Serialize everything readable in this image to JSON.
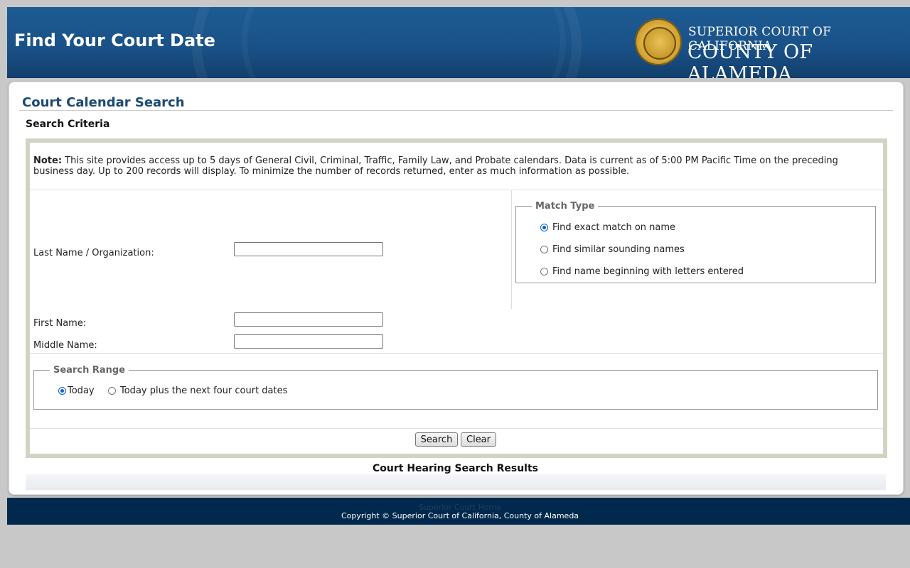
{
  "header": {
    "title": "Find Your Court Date",
    "court_line1": "SUPERIOR COURT OF CALIFORNIA",
    "court_line2": "COUNTY OF ALAMEDA"
  },
  "main": {
    "page_title": "Court Calendar Search",
    "criteria_heading": "Search Criteria",
    "note_label": "Note:",
    "note_text": " This site provides access up to 5 days of General Civil, Criminal, Traffic, Family Law, and Probate calendars. Data is current as of 5:00 PM Pacific Time on the preceding business day. Up to 200 records will display. To minimize the number of records returned, enter as much information as possible.",
    "fields": {
      "last_name_label": "Last Name / Organization:",
      "last_name_value": "",
      "first_name_label": "First Name:",
      "first_name_value": "",
      "middle_name_label": "Middle Name:",
      "middle_name_value": ""
    },
    "match_type": {
      "legend": "Match Type",
      "options": [
        {
          "label": "Find exact match on name",
          "checked": true
        },
        {
          "label": "Find similar sounding names",
          "checked": false
        },
        {
          "label": "Find name beginning with letters entered",
          "checked": false
        }
      ]
    },
    "search_range": {
      "legend": "Search Range",
      "options": [
        {
          "label": "Today",
          "checked": true
        },
        {
          "label": "Today plus the next four court dates",
          "checked": false
        }
      ]
    },
    "buttons": {
      "search": "Search",
      "clear": "Clear"
    },
    "results_heading": "Court Hearing Search Results"
  },
  "footer": {
    "home_link": "Superior Court Home",
    "copyright": "Copyright © Superior Court of California, County of Alameda"
  },
  "colors": {
    "banner": "#1a5288",
    "title_blue": "#1b4a72",
    "footer": "#00294d",
    "radio_accent": "#0b62d6"
  }
}
